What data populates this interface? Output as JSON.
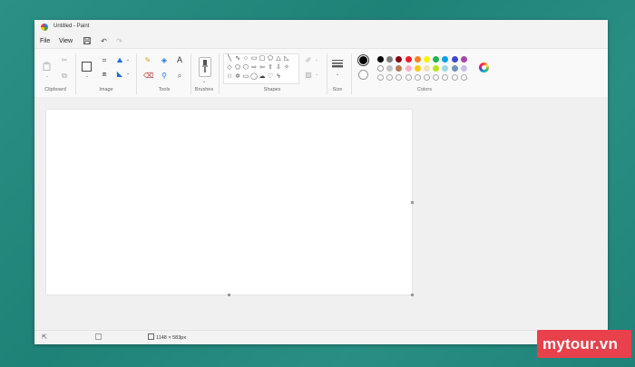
{
  "window": {
    "title": "Untitled - Paint"
  },
  "menu": {
    "file": "File",
    "view": "View"
  },
  "ribbon": {
    "groups": {
      "clipboard": "Clipboard",
      "image": "Image",
      "tools": "Tools",
      "brushes": "Brushes",
      "shapes": "Shapes",
      "size": "Size",
      "colors": "Colors"
    },
    "tools_text_glyph": "A"
  },
  "colors": {
    "primary": "#000000",
    "secondary": "#ffffff",
    "row1": [
      "#000000",
      "#7f7f7f",
      "#880015",
      "#ed1c24",
      "#ff7f27",
      "#fff200",
      "#22b14c",
      "#00a2e8",
      "#3f48cc",
      "#a349a4"
    ],
    "row2": [
      "#ffffff",
      "#c3c3c3",
      "#b97a57",
      "#ffaec9",
      "#ffc90e",
      "#efe4b0",
      "#b5e61d",
      "#99d9ea",
      "#7092be",
      "#c8bfe7"
    ],
    "row3_empty_count": 10
  },
  "status": {
    "canvas_size": "1148 × 583px"
  },
  "watermark": "mytour.vn"
}
